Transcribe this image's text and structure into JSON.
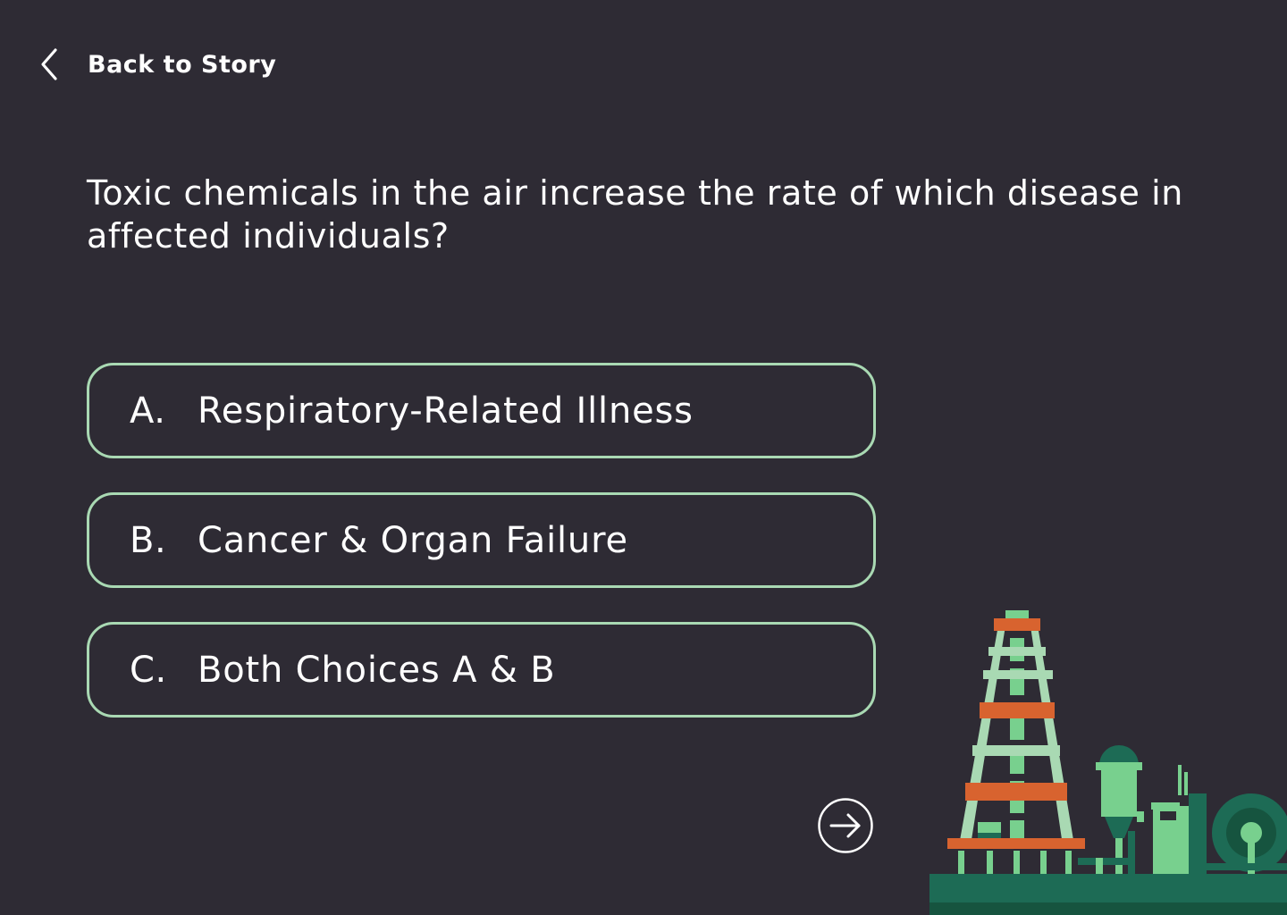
{
  "nav": {
    "back_label": "Back to Story"
  },
  "question": {
    "text": "Toxic chemicals in the air increase the rate of which disease in affected individuals?"
  },
  "choices": [
    {
      "letter": "A.",
      "text": "Respiratory-Related Illness"
    },
    {
      "letter": "B.",
      "text": "Cancer & Organ Failure"
    },
    {
      "letter": "C.",
      "text": "Both Choices A & B"
    }
  ],
  "icons": {
    "back": "chevron-left-icon",
    "next": "arrow-right-circle-icon"
  },
  "colors": {
    "background": "#2e2b34",
    "choice_border": "#a9d9b3",
    "text": "#ffffff",
    "tower_orange": "#d8632f",
    "tower_light_green": "#a9d9b3",
    "industry_green": "#78d08e",
    "industry_dark_green": "#1d6b55"
  }
}
